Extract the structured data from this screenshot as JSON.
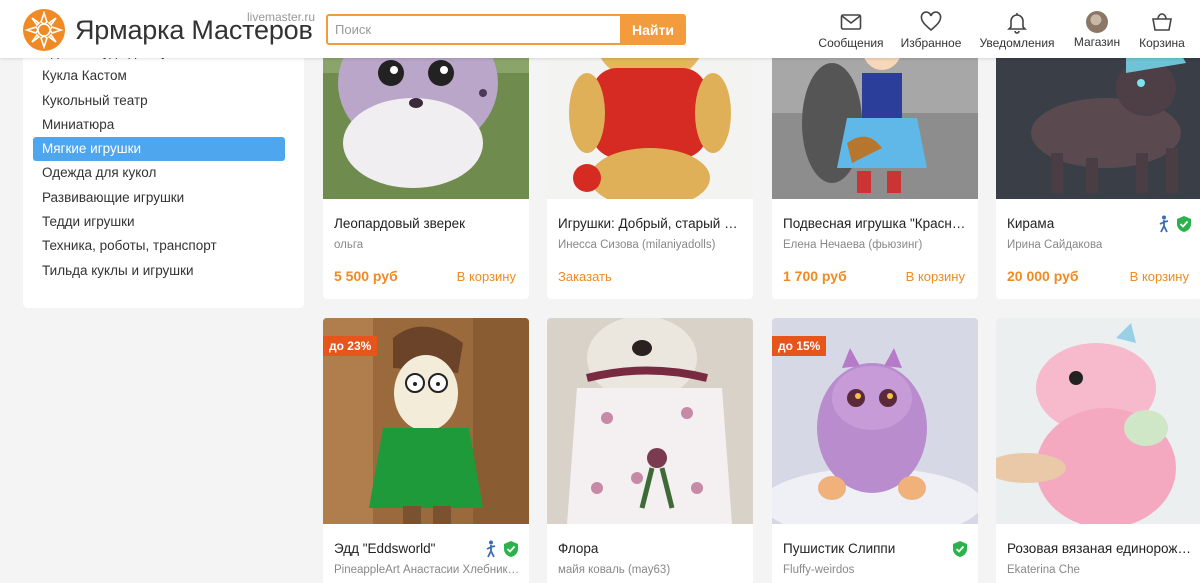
{
  "header": {
    "brand": "Ярмарка Мастеров",
    "domain": "livemaster.ru",
    "search_placeholder": "Поиск",
    "search_button": "Найти",
    "nav": [
      {
        "label": "Сообщения",
        "icon": "envelope-icon"
      },
      {
        "label": "Избранное",
        "icon": "heart-icon"
      },
      {
        "label": "Уведомления",
        "icon": "bell-icon"
      },
      {
        "label": "Магазин",
        "icon": "avatar"
      },
      {
        "label": "Корзина",
        "icon": "basket-icon"
      }
    ]
  },
  "sidebar": {
    "items": [
      {
        "label": "Еда и посуда для кукол"
      },
      {
        "label": "Кукла Кастом"
      },
      {
        "label": "Кукольный театр"
      },
      {
        "label": "Миниатюра"
      },
      {
        "label": "Мягкие игрушки",
        "active": true
      },
      {
        "label": "Одежда для кукол"
      },
      {
        "label": "Развивающие игрушки"
      },
      {
        "label": "Тедди игрушки"
      },
      {
        "label": "Техника, роботы, транспорт"
      },
      {
        "label": "Тильда куклы и игрушки"
      }
    ]
  },
  "products": [
    {
      "title": "Леопардовый зверек",
      "seller": "ольга",
      "price": "5 500 руб",
      "cart": "В корзину"
    },
    {
      "title": "Игрушки: Добрый, старый д…",
      "seller": "Инесса Сизова (milaniyadolls)",
      "order": "Заказать"
    },
    {
      "title": "Подвесная игрушка \"Красн…",
      "seller": "Елена Нечаева (фьюзинг)",
      "price": "1 700 руб",
      "cart": "В корзину"
    },
    {
      "title": "Кирама",
      "seller": "Ирина Сайдакова",
      "price": "20 000 руб",
      "cart": "В корзину",
      "verified": true,
      "walker": true
    },
    {
      "title": "Эдд \"Eddsworld\"",
      "seller": "PineappleArt Анастасии Хлебник…",
      "badge": "до 23%",
      "verified": true,
      "walker": true
    },
    {
      "title": "Флора",
      "seller": "майя коваль (may63)"
    },
    {
      "title": "Пушистик Слиппи",
      "seller": "Fluffy-weirdos",
      "badge": "до 15%",
      "verified": true
    },
    {
      "title": "Розовая вязаная единорож…",
      "seller": "Ekaterina Che"
    }
  ],
  "colors": {
    "accent": "#f39c3d",
    "price": "#f08a24",
    "active_category": "#4ea6ef",
    "badge": "#e8551b",
    "verified": "#2bb24c"
  }
}
